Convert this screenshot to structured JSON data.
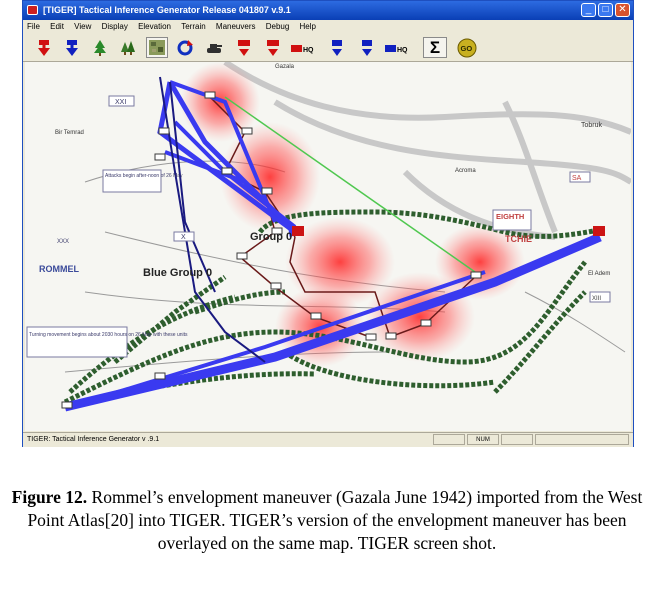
{
  "window": {
    "title": "[TIGER] Tactical Inference Generator Release 041807 v.9.1",
    "minimize": "_",
    "maximize": "□",
    "close": "✕"
  },
  "menu": [
    "File",
    "Edit",
    "View",
    "Display",
    "Elevation",
    "Terrain",
    "Maneuvers",
    "Debug",
    "Help"
  ],
  "toolbar": {
    "buttons": [
      {
        "icon": "red-down-arrow-icon"
      },
      {
        "icon": "blue-down-arrow-icon"
      },
      {
        "icon": "tree-icon"
      },
      {
        "icon": "forest-icon"
      },
      {
        "icon": "terrain-map-icon"
      },
      {
        "icon": "refresh-icon"
      },
      {
        "icon": "tank-icon"
      },
      {
        "icon": "red-unit-down-icon"
      },
      {
        "icon": "red-unit-down-2-icon"
      },
      {
        "icon": "red-hq-icon",
        "label": "HQ"
      },
      {
        "icon": "blue-unit-down-icon"
      },
      {
        "icon": "blue-unit-down-2-icon"
      },
      {
        "icon": "blue-hq-icon",
        "label": "HQ"
      },
      {
        "icon": "sigma-icon",
        "label": "Σ"
      },
      {
        "icon": "go-icon",
        "label": "GO"
      }
    ]
  },
  "map": {
    "labels": {
      "red_group": "Group 0",
      "blue_group": "Blue Group 0",
      "rommel": "ROMMEL",
      "tobruk": "Tobruk",
      "eighth": "EIGHTH",
      "tchie": "TCHIE",
      "el_adem": "El Adem",
      "acroma": "Acroma",
      "bir_tengeder": "Bir Temrad",
      "gazala": "Gazala",
      "attack_note": "Attacks begin after-noon of 26 May",
      "turning_note": "Turning movement begins about 2030 hours on 26 May with these units",
      "xxi": "XXI",
      "corps_x": "X",
      "xxx": "XXX",
      "sa": "SA",
      "xiii": "XIII"
    },
    "colors": {
      "blue_route": "#3a3af0",
      "red_heat": "#ff3030",
      "green_path": "#2e5e2e",
      "link_line": "#50c850"
    }
  },
  "statusbar": {
    "text": "TIGER: Tactical Inference Generator v .9.1",
    "num": "NUM"
  },
  "caption": {
    "bold": "Figure 12.",
    "text": " Rommel’s envelopment maneuver (Gazala June 1942) imported from the West Point Atlas[20] into TIGER. TIGER’s version of the  envelopment maneuver has been overlayed on the same map. TIGER screen shot."
  }
}
